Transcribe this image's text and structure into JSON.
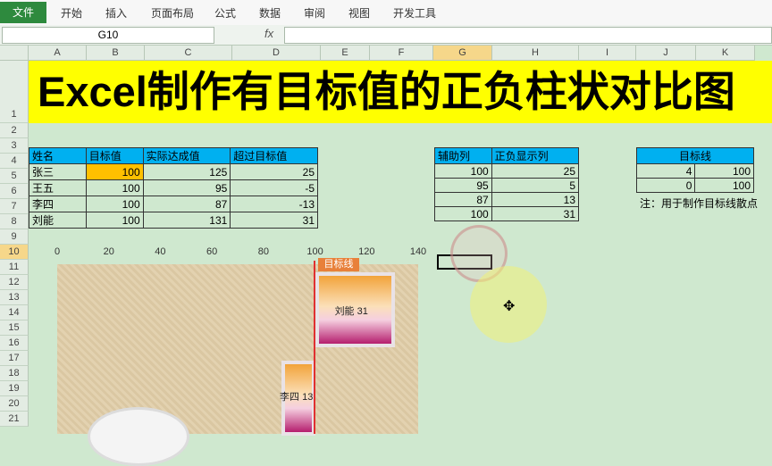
{
  "ribbon": {
    "file": "文件",
    "tabs": [
      "开始",
      "插入",
      "页面布局",
      "公式",
      "数据",
      "审阅",
      "视图",
      "开发工具"
    ]
  },
  "formula": {
    "namebox": "G10",
    "fx": "fx",
    "content": ""
  },
  "columns": [
    "A",
    "B",
    "C",
    "D",
    "E",
    "F",
    "G",
    "H",
    "I",
    "J",
    "K"
  ],
  "rows": [
    "1",
    "2",
    "3",
    "4",
    "5",
    "6",
    "7",
    "8",
    "9",
    "10",
    "11",
    "12",
    "13",
    "14",
    "15",
    "16",
    "17",
    "18",
    "19",
    "20",
    "21"
  ],
  "title": "Excel制作有目标值的正负柱状对比图",
  "table1": {
    "headers": [
      "姓名",
      "目标值",
      "实际达成值",
      "超过目标值"
    ],
    "rows": [
      [
        "张三",
        "100",
        "125",
        "25"
      ],
      [
        "王五",
        "100",
        "95",
        "-5"
      ],
      [
        "李四",
        "100",
        "87",
        "-13"
      ],
      [
        "刘能",
        "100",
        "131",
        "31"
      ]
    ]
  },
  "table2": {
    "headers": [
      "辅助列",
      "正负显示列"
    ],
    "rows": [
      [
        "100",
        "25"
      ],
      [
        "95",
        "5"
      ],
      [
        "87",
        "13"
      ],
      [
        "100",
        "31"
      ]
    ]
  },
  "table3": {
    "header": "目标线",
    "rows": [
      [
        "4",
        "100"
      ],
      [
        "0",
        "100"
      ]
    ]
  },
  "note": "注：用于制作目标线散点",
  "chart_data": {
    "type": "bar",
    "orientation": "horizontal",
    "x_ticks": [
      "0",
      "20",
      "40",
      "60",
      "80",
      "100",
      "120",
      "140"
    ],
    "xlim": [
      0,
      140
    ],
    "target_line": {
      "value": 100,
      "label": "目标线"
    },
    "bars": [
      {
        "label": "刘能 31",
        "base": 100,
        "value": 131
      },
      {
        "label": "李四 13",
        "base": 87,
        "value": 100
      }
    ]
  },
  "colors": {
    "header_fill": "#00b0f0",
    "title_fill": "#ffff00",
    "highlight": "#ffc000",
    "file_tab": "#2e8a3e",
    "target_line": "#e03030"
  },
  "icons": {
    "cursor": "crosshair-cursor-icon"
  }
}
